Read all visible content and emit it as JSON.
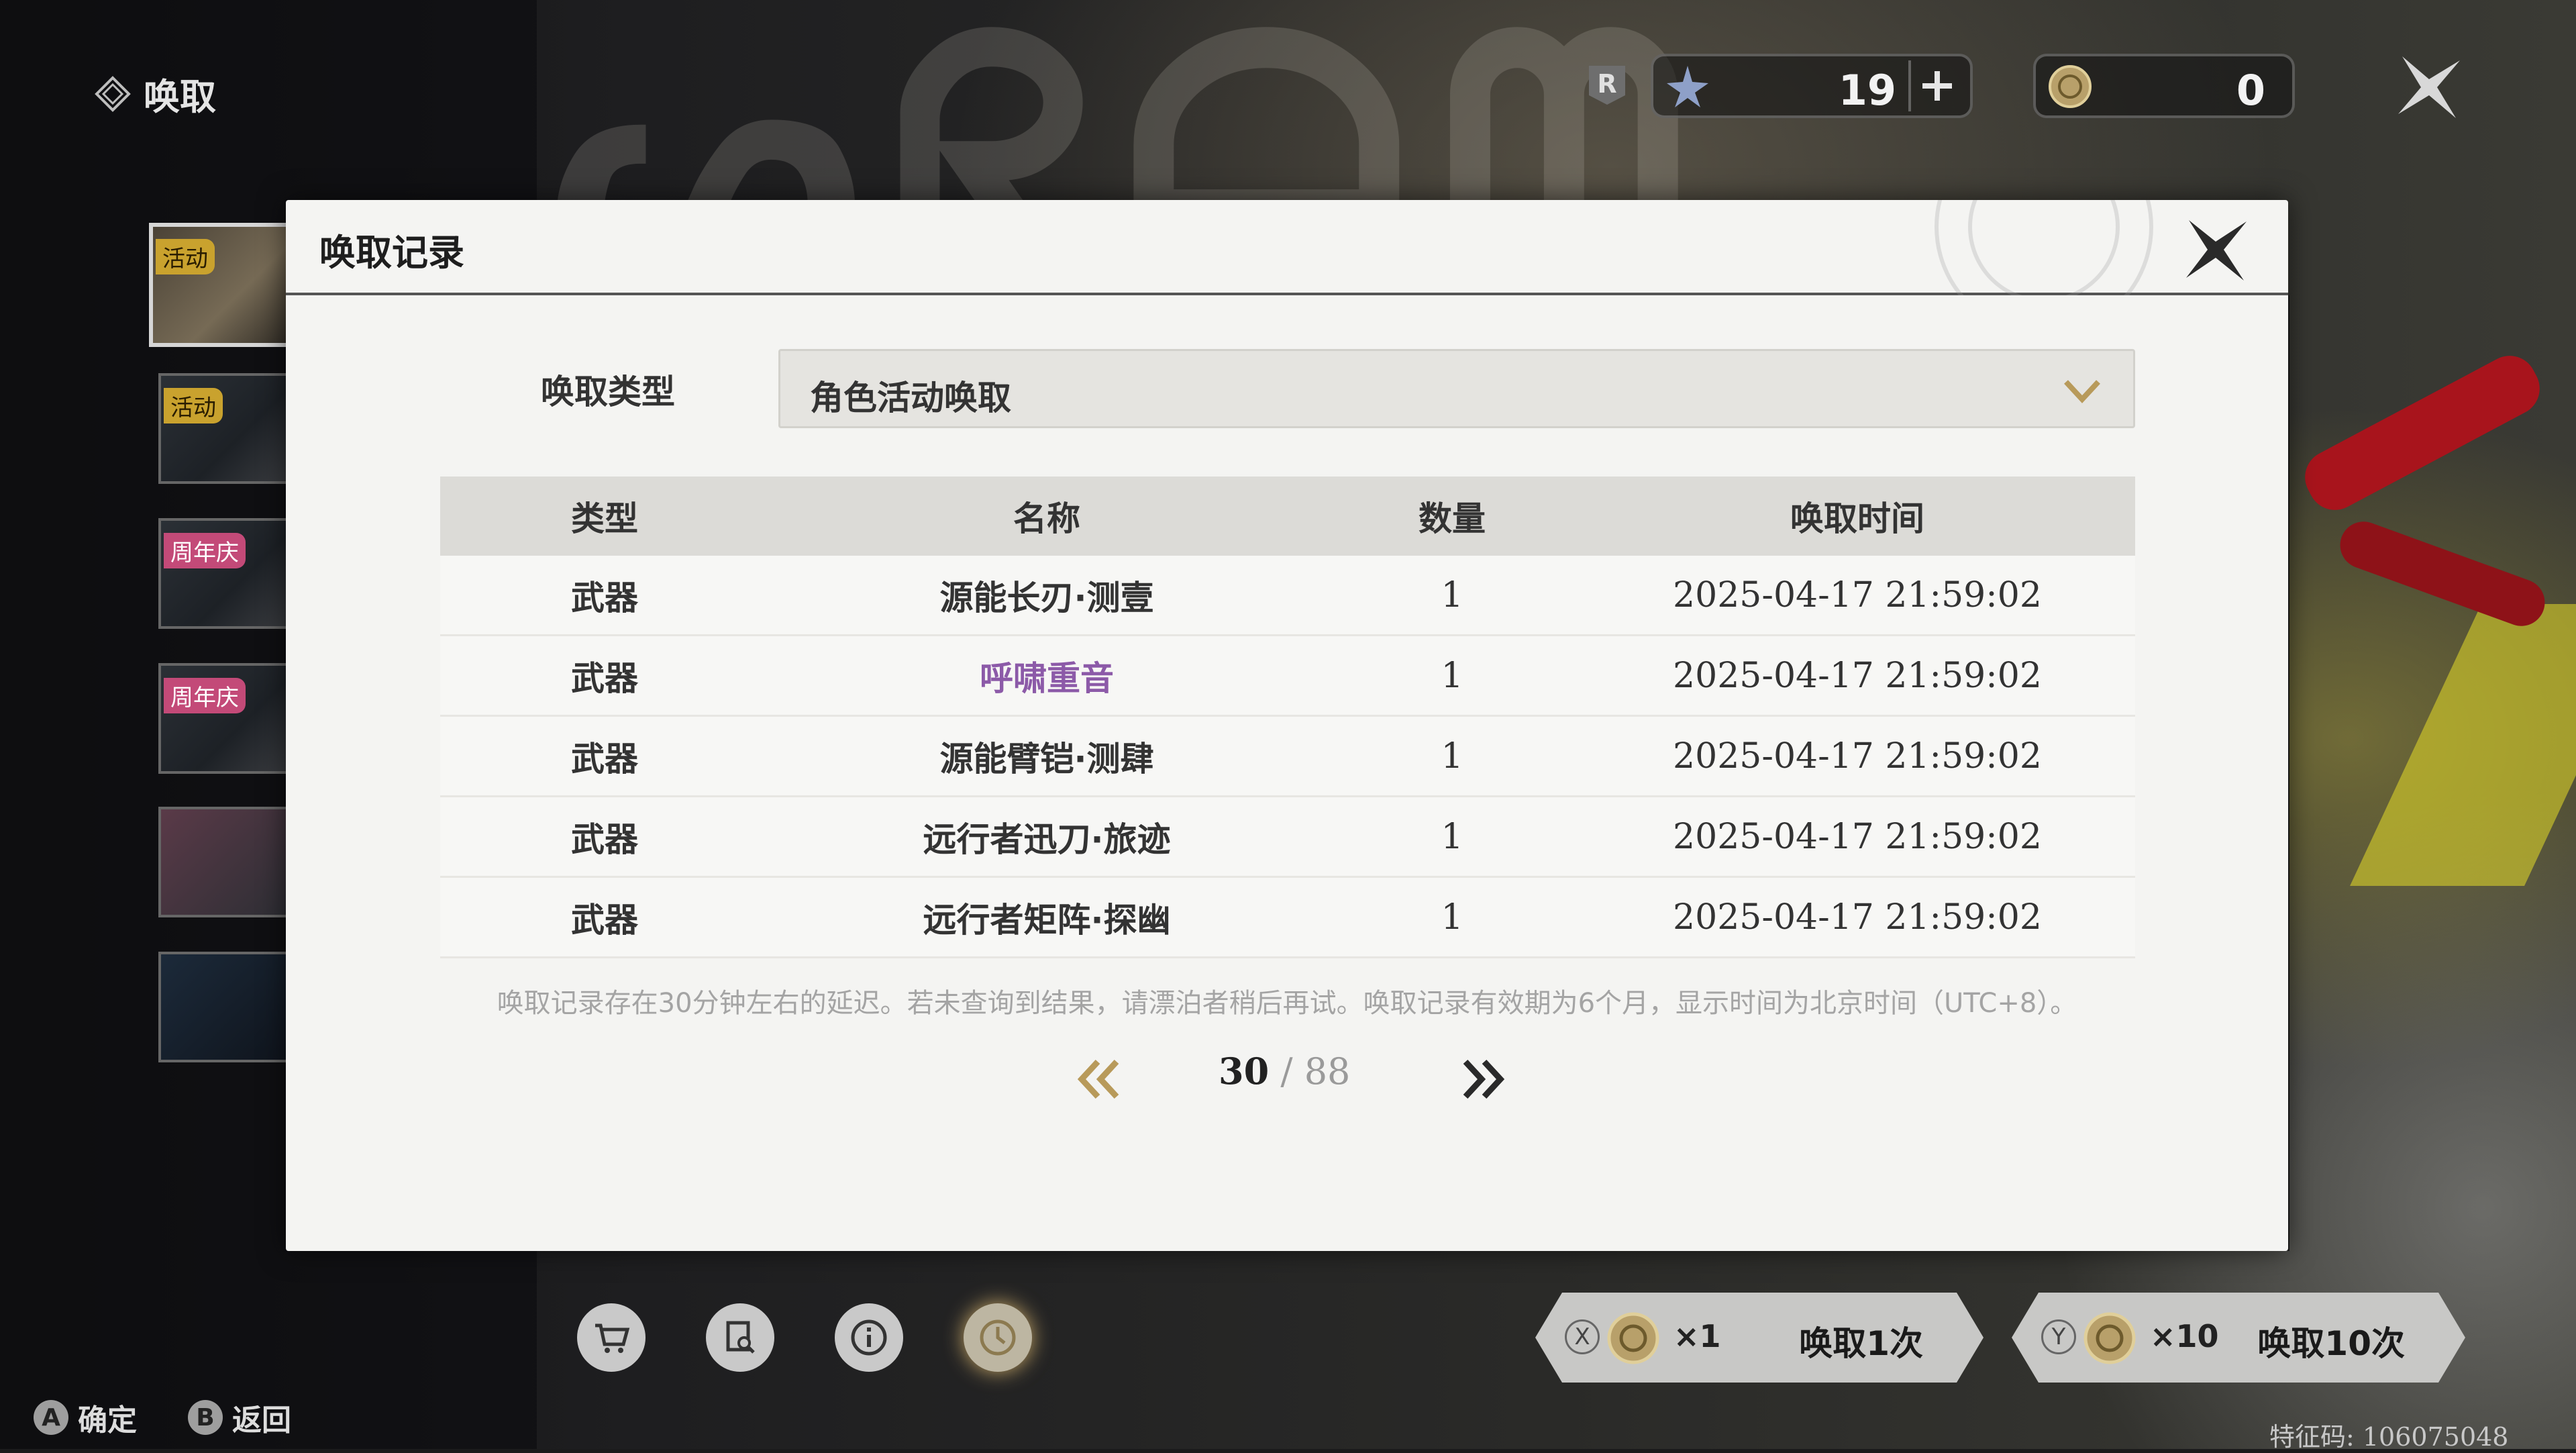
{
  "page": {
    "title": "唤取"
  },
  "currency": {
    "ticket_value": "19",
    "coin_value": "0"
  },
  "banners": [
    {
      "tag": "活动",
      "tag_type": "event"
    },
    {
      "tag": "活动",
      "tag_type": "event"
    },
    {
      "tag": "周年庆",
      "tag_type": "anniv"
    },
    {
      "tag": "周年庆",
      "tag_type": "anniv"
    },
    {
      "tag": "",
      "tag_type": ""
    },
    {
      "tag": "",
      "tag_type": ""
    }
  ],
  "modal": {
    "title": "唤取记录",
    "type_label": "唤取类型",
    "type_value": "角色活动唤取",
    "columns": [
      "类型",
      "名称",
      "数量",
      "唤取时间"
    ],
    "rows": [
      {
        "type": "武器",
        "name": "源能长刃·测壹",
        "qty": "1",
        "time": "2025-04-17 21:59:02",
        "rarity_color": "#333333"
      },
      {
        "type": "武器",
        "name": "呼啸重音",
        "qty": "1",
        "time": "2025-04-17 21:59:02",
        "rarity_color": "#8c5aa8"
      },
      {
        "type": "武器",
        "name": "源能臂铠·测肆",
        "qty": "1",
        "time": "2025-04-17 21:59:02",
        "rarity_color": "#333333"
      },
      {
        "type": "武器",
        "name": "远行者迅刀·旅迹",
        "qty": "1",
        "time": "2025-04-17 21:59:02",
        "rarity_color": "#333333"
      },
      {
        "type": "武器",
        "name": "远行者矩阵·探幽",
        "qty": "1",
        "time": "2025-04-17 21:59:02",
        "rarity_color": "#333333"
      }
    ],
    "notice": "唤取记录存在30分钟左右的延迟。若未查询到结果，请漂泊者稍后再试。唤取记录有效期为6个月，显示时间为北京时间（UTC+8）。",
    "pagination": {
      "current": "30",
      "separator": " / ",
      "total": "88"
    }
  },
  "bottom": {
    "hints": [
      {
        "key": "A",
        "label": "确定"
      },
      {
        "key": "B",
        "label": "返回"
      }
    ],
    "pull_one": {
      "key": "X",
      "mult": "×1",
      "label": "唤取1次"
    },
    "pull_ten": {
      "key": "Y",
      "mult": "×10",
      "label": "唤取10次"
    },
    "uid": "特征码: 106075048"
  },
  "colors": {
    "accent_gold": "#b89a5a",
    "purple_rarity": "#8c5aa8"
  }
}
